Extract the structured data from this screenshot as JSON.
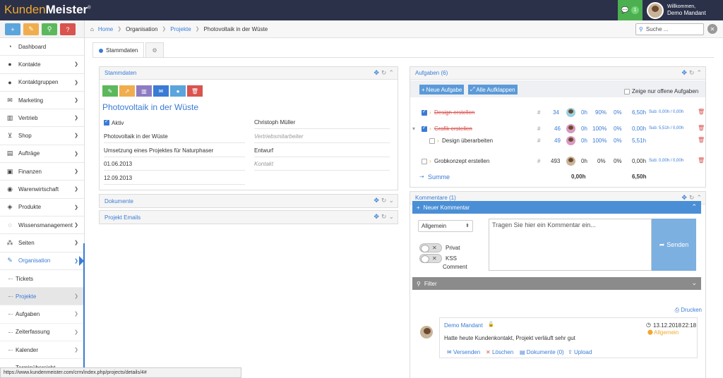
{
  "brand": {
    "part1": "Kunden",
    "part2": "Meister",
    "mark": "®"
  },
  "header": {
    "notifications": {
      "count": "1"
    },
    "user": {
      "greeting": "Willkommen,",
      "name": "Demo Mandant"
    }
  },
  "quick_actions": [
    {
      "icon": "plus-icon",
      "glyph": "+",
      "color": "#5ba4dc"
    },
    {
      "icon": "chat-icon",
      "glyph": "✎",
      "color": "#f0ad4e"
    },
    {
      "icon": "search-icon",
      "glyph": "⚲",
      "color": "#5cb85c"
    },
    {
      "icon": "help-icon",
      "glyph": "?",
      "color": "#d9534f"
    }
  ],
  "sidebar": {
    "items": [
      {
        "label": "Dashboard",
        "icon": "dashboard-icon",
        "glyph": "◔"
      },
      {
        "label": "Kontakte",
        "icon": "user-icon",
        "glyph": "●"
      },
      {
        "label": "Kontaktgruppen",
        "icon": "users-icon",
        "glyph": "●"
      },
      {
        "label": "Marketing",
        "icon": "mail-icon",
        "glyph": "✉"
      },
      {
        "label": "Vertrieb",
        "icon": "chart-icon",
        "glyph": "▥"
      },
      {
        "label": "Shop",
        "icon": "cart-icon",
        "glyph": "⊻"
      },
      {
        "label": "Aufträge",
        "icon": "file-icon",
        "glyph": "▤"
      },
      {
        "label": "Finanzen",
        "icon": "money-icon",
        "glyph": "▣"
      },
      {
        "label": "Warenwirtschaft",
        "icon": "globe-icon",
        "glyph": "◉"
      },
      {
        "label": "Produkte",
        "icon": "box-icon",
        "glyph": "◈"
      },
      {
        "label": "Wissensmanagement",
        "icon": "lightbulb-icon",
        "glyph": "◌"
      },
      {
        "label": "Seiten",
        "icon": "sitemap-icon",
        "glyph": "⁂"
      },
      {
        "label": "Organisation",
        "icon": "edit-icon",
        "glyph": "✎"
      }
    ],
    "sub_items": [
      {
        "label": "Tickets"
      },
      {
        "label": "Projekte"
      },
      {
        "label": "Aufgaben"
      },
      {
        "label": "Zeiterfassung"
      },
      {
        "label": "Kalender"
      },
      {
        "label": "Terminübersicht"
      }
    ]
  },
  "breadcrumb": {
    "home": "Home",
    "org": "Organisation",
    "projects": "Projekte",
    "current": "Photovoltaik in der Wüste"
  },
  "search": {
    "placeholder": "Suche ..."
  },
  "tabs": {
    "main": "Stammdaten"
  },
  "stammdaten": {
    "title": "Stammdaten",
    "project_title": "Photovoltaik in der Wüste",
    "active_label": "Aktiv",
    "name": "Photovoltaik in der Wüste",
    "description": "Umsetzung eines Projektes für Naturphaser",
    "start": "01.06.2013",
    "end": "12.09.2013",
    "owner": "Christoph Müller",
    "sales_placeholder": "Vertriebsmitarbeiter",
    "status": "Entwurf",
    "contact_placeholder": "Kontakt"
  },
  "documents": {
    "title": "Dokumente"
  },
  "emails": {
    "title": "Projekt Emails"
  },
  "tasks": {
    "title": "Aufgaben (6)",
    "new_btn": "Neue Aufgabe",
    "collapse_btn": "Alle Aufklappen",
    "open_only": "Zeige nur offene Aufgaben",
    "rows": [
      {
        "name": "Design erstellen",
        "hash": "#",
        "id": "34",
        "h": "0h",
        "pct": "90%",
        "pct2": "0%",
        "total": "6,50h",
        "sub": "Sub: 0,00h / 0,00h",
        "done": true
      },
      {
        "name": "Grafik erstellen",
        "hash": "#",
        "id": "46",
        "h": "0h",
        "pct": "100%",
        "pct2": "0%",
        "total": "0,00h",
        "sub": "Sub: 5,51h / 0,00h",
        "done": true
      },
      {
        "name": "Design überarbeiten",
        "hash": "#",
        "id": "49",
        "h": "0h",
        "pct": "100%",
        "pct2": "0%",
        "total": "5,51h",
        "sub": "",
        "done": false
      },
      {
        "name": "Grobkonzept erstellen",
        "hash": "#",
        "id": "493",
        "h": "0h",
        "pct": "0%",
        "pct2": "0%",
        "total": "0,00h",
        "sub": "Sub: 0,00h / 0,00h",
        "done": false
      }
    ],
    "sum_label": "Summe",
    "sum_h": "0,00h",
    "sum_total": "6,50h"
  },
  "comments": {
    "title": "Kommentare (1)",
    "new_label": "Neuer Kommentar",
    "category": "Allgemein",
    "privat": "Privat",
    "kss": "KSS",
    "comment_word": "Comment",
    "placeholder": "Tragen Sie hier ein Kommentar ein...",
    "send": "Senden",
    "filter": "Filter",
    "print": "Drucken",
    "entry": {
      "author": "Demo Mandant",
      "date": "13.12.2018",
      "time": "22:18",
      "tag": "Allgemein",
      "text": "Hatte heute Kundenkontakt, Projekt verläuft sehr gut",
      "send": "Versenden",
      "delete": "Löschen",
      "docs": "Dokumente (0)",
      "upload": "Upload"
    }
  },
  "statusbar": {
    "url": "https://www.kundenmeister.com/crm/index.php/projects/details/4#"
  }
}
